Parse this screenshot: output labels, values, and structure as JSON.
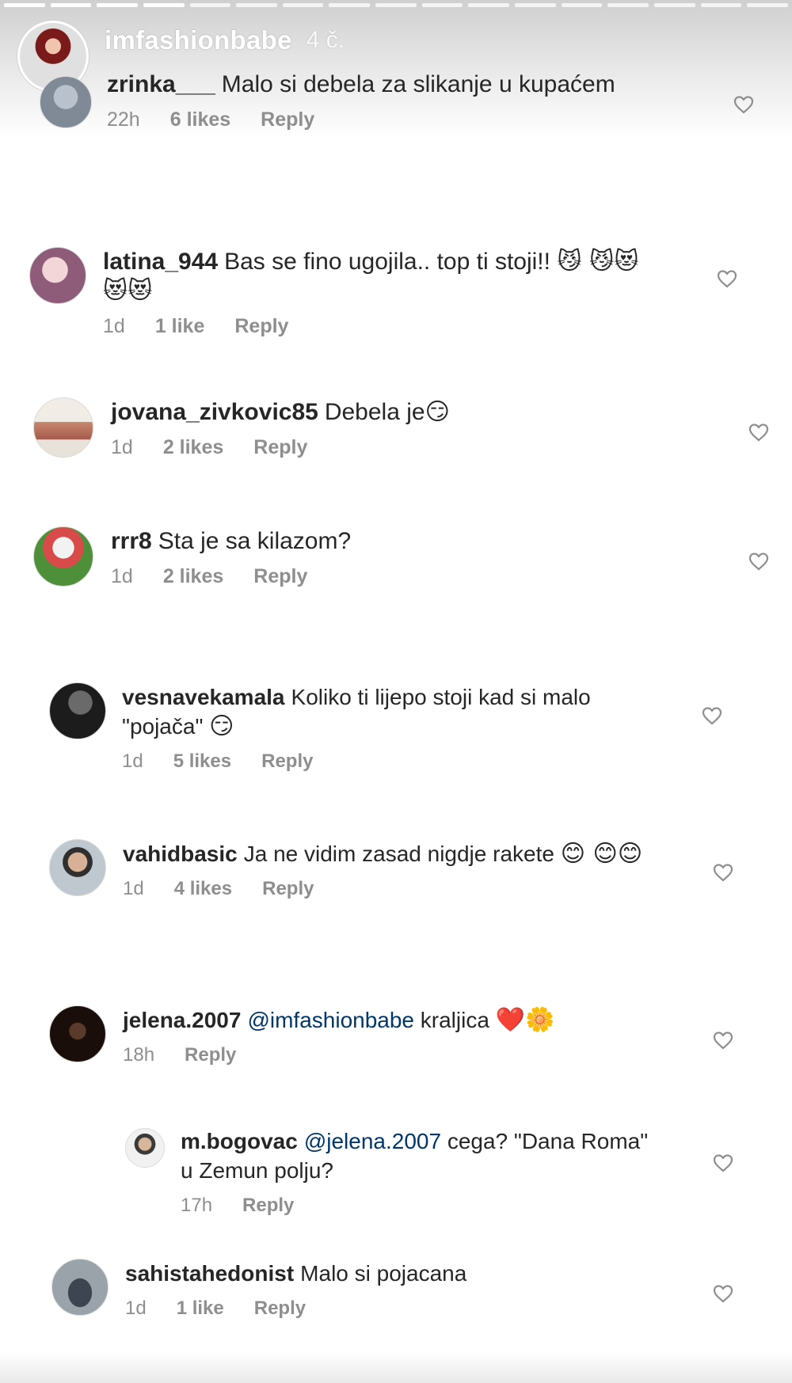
{
  "story": {
    "username": "imfashionbabe",
    "time": "4 č."
  },
  "comments": [
    {
      "username": "zrinka___",
      "text": "Malo si debela za slikanje u kupaćem",
      "emoji": "",
      "time": "22h",
      "likes": "6 likes",
      "reply": "Reply",
      "avatar": "avatar-zrinka"
    },
    {
      "username": "latina_944",
      "text": "Bas se fino ugojila.. top ti stoji!!",
      "emoji": "😼 😼😻😻😻",
      "time": "1d",
      "likes": "1 like",
      "reply": "Reply",
      "avatar": "avatar-latina"
    },
    {
      "username": "jovana_zivkovic85",
      "text": "Debela je",
      "emoji": "😏",
      "time": "1d",
      "likes": "2 likes",
      "reply": "Reply",
      "avatar": "avatar-jovana"
    },
    {
      "username": "rrr8",
      "text": "Sta je sa kilazom?",
      "emoji": "",
      "time": "1d",
      "likes": "2 likes",
      "reply": "Reply",
      "avatar": "avatar-rrr8"
    },
    {
      "username": "vesnavekamala",
      "text": "Koliko ti lijepo stoji kad si malo \"pojača\"",
      "emoji": "😏",
      "time": "1d",
      "likes": "5 likes",
      "reply": "Reply",
      "avatar": "avatar-vesna"
    },
    {
      "username": "vahidbasic",
      "text": "Ja ne vidim zasad nigdje rakete",
      "emoji": "😊 😊😊",
      "time": "1d",
      "likes": "4 likes",
      "reply": "Reply",
      "avatar": "avatar-vahid"
    },
    {
      "username": "jelena.2007",
      "mention": "@imfashionbabe",
      "text": "kraljica",
      "emoji": "❤️🌼",
      "time": "18h",
      "likes": "",
      "reply": "Reply",
      "avatar": "avatar-jelena"
    },
    {
      "username": "m.bogovac",
      "mention": "@jelena.2007",
      "text": "cega? \"Dana Roma\" u Zemun polju?",
      "emoji": "",
      "time": "17h",
      "likes": "",
      "reply": "Reply",
      "avatar": "avatar-bogovac"
    },
    {
      "username": "sahistahedonist",
      "text": "Malo si pojacana",
      "emoji": "",
      "time": "1d",
      "likes": "1 like",
      "reply": "Reply",
      "avatar": "avatar-sahista"
    }
  ]
}
